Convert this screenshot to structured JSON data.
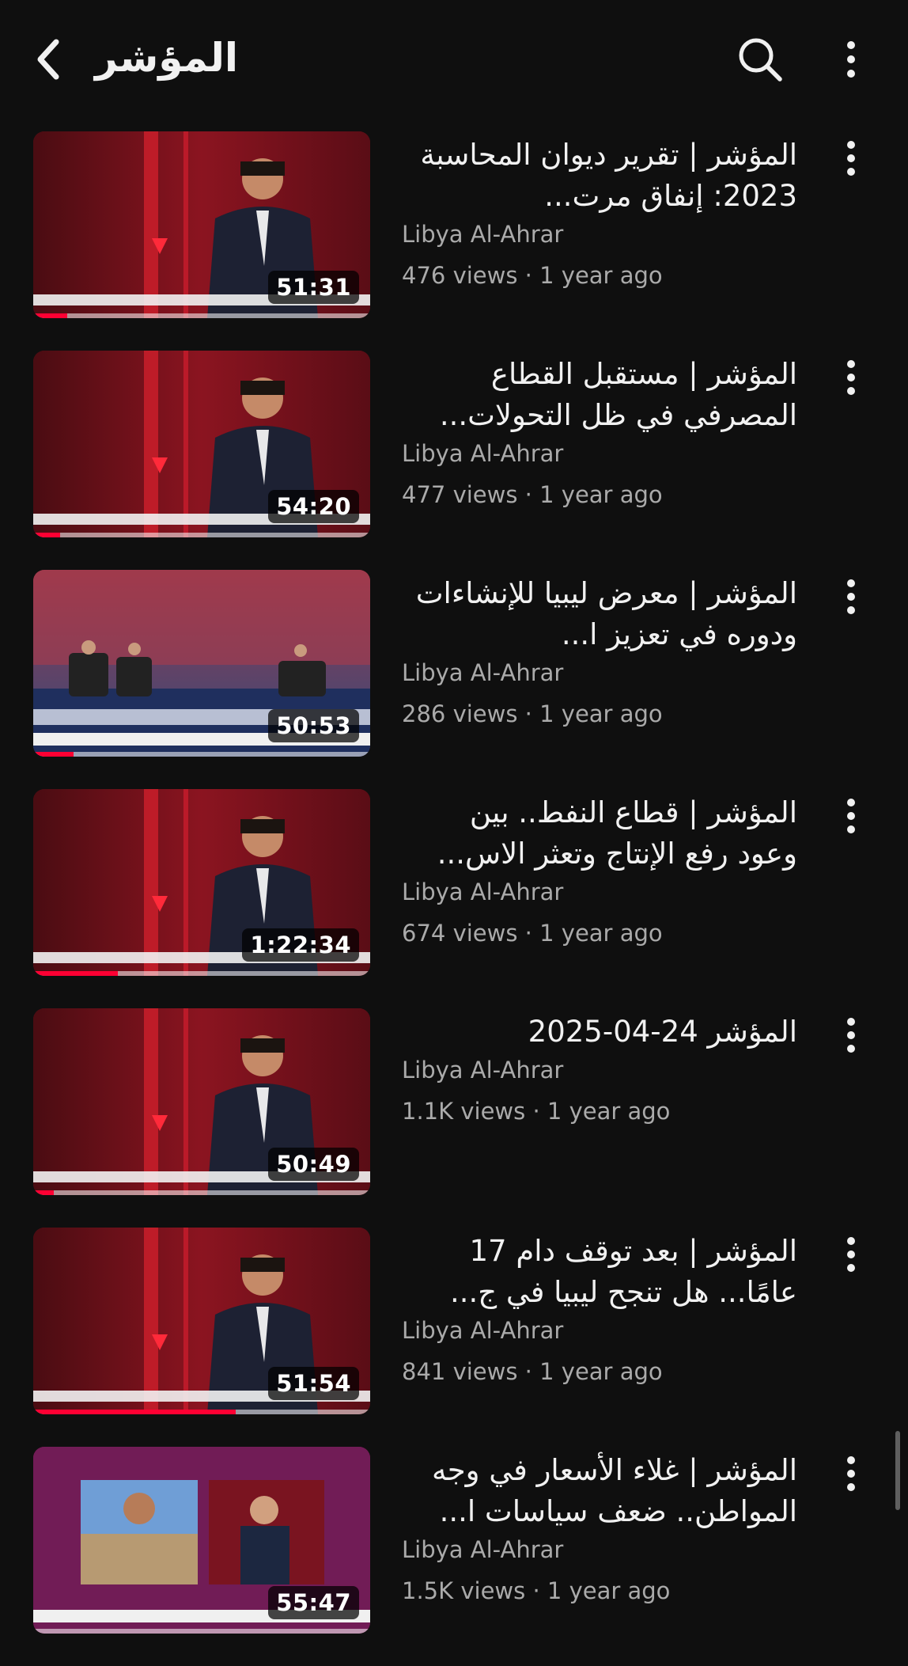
{
  "header": {
    "title": "المؤشر",
    "back_icon": "chevron-left-icon",
    "search_icon": "search-icon",
    "menu_icon": "more-vertical-icon"
  },
  "colors": {
    "background": "#0f0f0f",
    "text_primary": "#f1f1f1",
    "text_secondary": "#aaaaaa",
    "progress": "#ff0033"
  },
  "videos": [
    {
      "title": "المؤشر | تقرير ديوان المحاسبة 2023: إنفاق مرت...",
      "channel": "Libya Al-Ahrar",
      "meta": "476 views · 1 year ago",
      "duration": "51:31",
      "progress": 0.1,
      "thumb_style": "red-studio"
    },
    {
      "title": "المؤشر | مستقبل القطاع المصرفي في ظل التحولات...",
      "channel": "Libya Al-Ahrar",
      "meta": "477 views · 1 year ago",
      "duration": "54:20",
      "progress": 0.08,
      "thumb_style": "red-studio"
    },
    {
      "title": "المؤشر | معرض ليبيا للإنشاءات ودوره في تعزيز ا...",
      "channel": "Libya Al-Ahrar",
      "meta": "286 views · 1 year ago",
      "duration": "50:53",
      "progress": 0.12,
      "thumb_style": "blue-studio"
    },
    {
      "title": "المؤشر | قطاع النفط.. بين وعود رفع الإنتاج وتعثر الاس...",
      "channel": "Libya Al-Ahrar",
      "meta": "674 views · 1 year ago",
      "duration": "1:22:34",
      "progress": 0.25,
      "thumb_style": "red-studio"
    },
    {
      "title": "المؤشر 24-04-2025",
      "channel": "Libya Al-Ahrar",
      "meta": "1.1K views · 1 year ago",
      "duration": "50:49",
      "progress": 0.06,
      "thumb_style": "red-studio"
    },
    {
      "title": "المؤشر | بعد توقف دام 17 عامًا... هل تنجح ليبيا في ج...",
      "channel": "Libya Al-Ahrar",
      "meta": "841 views · 1 year ago",
      "duration": "51:54",
      "progress": 0.6,
      "thumb_style": "red-studio"
    },
    {
      "title": "المؤشر | غلاء الأسعار في وجه المواطن.. ضعف سياسات ا...",
      "channel": "Libya Al-Ahrar",
      "meta": "1.5K views · 1 year ago",
      "duration": "55:47",
      "progress": 0.0,
      "thumb_style": "purple-split"
    }
  ]
}
